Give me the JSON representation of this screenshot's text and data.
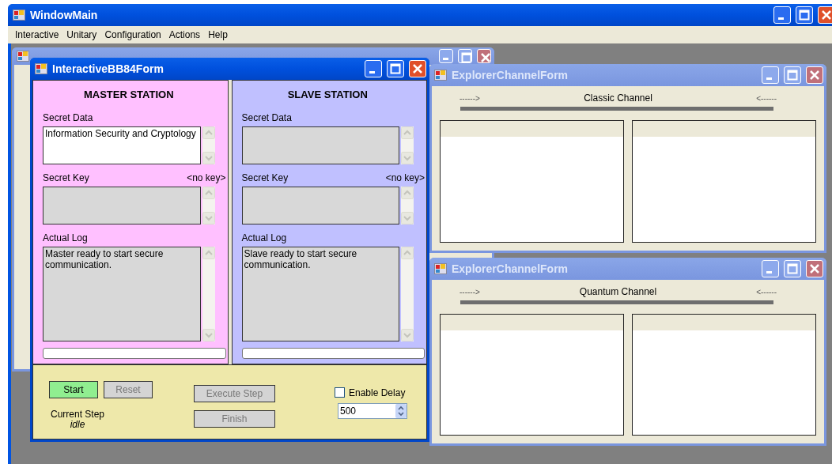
{
  "main_window": {
    "title": "WindowMain",
    "menu": [
      {
        "label": "Interactive"
      },
      {
        "label": "Unitary"
      },
      {
        "label": "Configuration"
      },
      {
        "label": "Actions"
      },
      {
        "label": "Help"
      }
    ]
  },
  "bb84_form": {
    "title": "InteractiveBB84Form",
    "active": true,
    "stations": [
      {
        "heading": "MASTER STATION",
        "color": "#ffc0ff",
        "secret_data_label": "Secret Data",
        "secret_data": "Information Security and Cryptology",
        "secret_data_disabled": false,
        "secret_key_label": "Secret Key",
        "key_status": "<no key>",
        "log_label": "Actual Log",
        "log": "Master ready to start secure communication."
      },
      {
        "heading": "SLAVE STATION",
        "color": "#c0c0ff",
        "secret_data_label": "Secret Data",
        "secret_data_disabled": true,
        "secret_key_label": "Secret Key",
        "key_status": "<no key>",
        "log_label": "Actual Log",
        "log": "Slave ready to start secure communication."
      }
    ],
    "buttons": [
      {
        "label": "Start",
        "disabled": false,
        "color": "#90ee90"
      },
      {
        "label": "Reset",
        "disabled": true,
        "color": "#d4d4d4"
      },
      {
        "label": "Execute Step",
        "disabled": true,
        "color": "#d4d4d4"
      },
      {
        "label": "Finish",
        "disabled": true,
        "color": "#d4d4d4"
      }
    ],
    "current_step_label": "Current Step",
    "current_step": "idle",
    "delay": {
      "label": "Enable Delay",
      "checked": false,
      "value": "500"
    }
  },
  "channel_windows": [
    {
      "title": "ExplorerChannelForm",
      "active": false,
      "channel": "Classic Channel",
      "left_arrow": "------>",
      "right_arrow": "<------"
    },
    {
      "title": "ExplorerChannelForm",
      "active": false,
      "channel": "Quantum Channel",
      "left_arrow": "------>",
      "right_arrow": "<------"
    }
  ]
}
